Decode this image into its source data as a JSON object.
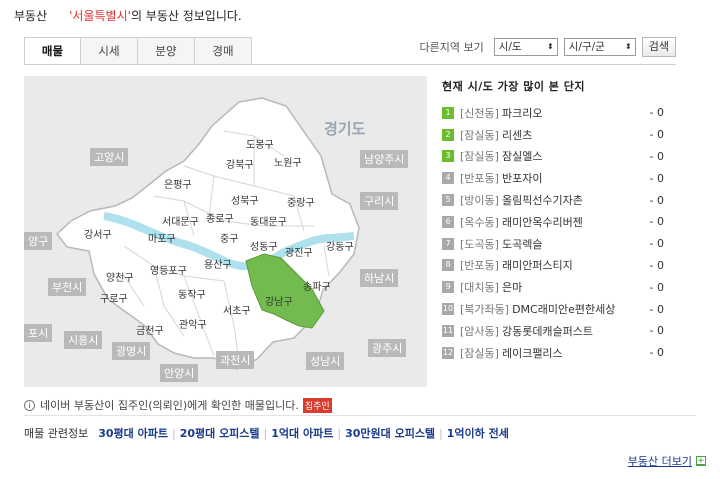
{
  "header": {
    "category": "부동산",
    "city": "'서울특별시'",
    "suffix": "의 부동산 정보입니다."
  },
  "tabs": [
    "매물",
    "시세",
    "분양",
    "경매"
  ],
  "region_select": {
    "label": "다른지역 보기",
    "sido": "시/도",
    "sigungu": "시/구/군",
    "search": "검색"
  },
  "map": {
    "province": "경기도",
    "outer": [
      "고양시",
      "남양주시",
      "구리시",
      "하남시",
      "부천시",
      "광명시",
      "시흥시",
      "안양시",
      "과천시",
      "성남시",
      "광주시",
      "양구",
      "포시"
    ],
    "districts": [
      "도봉구",
      "노원구",
      "강북구",
      "은평구",
      "성북구",
      "중랑구",
      "서대문구",
      "종로구",
      "동대문구",
      "강서구",
      "마포구",
      "중구",
      "성동구",
      "광진구",
      "강동구",
      "양천구",
      "영등포구",
      "용산구",
      "구로구",
      "동작구",
      "송파구",
      "금천구",
      "관악구",
      "서초구",
      "강남구"
    ]
  },
  "list_title": "현재 시/도 가장 많이 본 단지",
  "complexes": [
    {
      "rank": "1",
      "dong": "[신천동]",
      "name": "파크리오",
      "count": "- 0"
    },
    {
      "rank": "2",
      "dong": "[잠실동]",
      "name": "리센츠",
      "count": "- 0"
    },
    {
      "rank": "3",
      "dong": "[잠실동]",
      "name": "잠실엘스",
      "count": "- 0"
    },
    {
      "rank": "4",
      "dong": "[반포동]",
      "name": "반포자이",
      "count": "- 0"
    },
    {
      "rank": "5",
      "dong": "[방이동]",
      "name": "올림픽선수기자촌",
      "count": "- 0"
    },
    {
      "rank": "6",
      "dong": "[옥수동]",
      "name": "래미안옥수리버젠",
      "count": "- 0"
    },
    {
      "rank": "7",
      "dong": "[도곡동]",
      "name": "도곡렉슬",
      "count": "- 0"
    },
    {
      "rank": "8",
      "dong": "[반포동]",
      "name": "래미안퍼스티지",
      "count": "- 0"
    },
    {
      "rank": "9",
      "dong": "[대치동]",
      "name": "은마",
      "count": "- 0"
    },
    {
      "rank": "10",
      "dong": "[북가좌동]",
      "name": "DMC래미안e편한세상",
      "count": "- 0"
    },
    {
      "rank": "11",
      "dong": "[암사동]",
      "name": "강동롯데캐슬퍼스트",
      "count": "- 0"
    },
    {
      "rank": "12",
      "dong": "[잠실동]",
      "name": "레이크팰리스",
      "count": "- 0"
    }
  ],
  "notice": {
    "text": "네이버 부동산이 집주인(의뢰인)에게 확인한 매물입니다.",
    "badge": "집주인"
  },
  "related": {
    "label": "매물 관련정보",
    "links": [
      "30평대 아파트",
      "20평대 오피스텔",
      "1억대 아파트",
      "30만원대 오피스텔",
      "1억이하 전세"
    ]
  },
  "more": "부동산 더보기",
  "colors": {
    "accent_red": "#e0312f",
    "selected_green": "#6cbd2e",
    "link_blue": "#1a3a8c"
  }
}
